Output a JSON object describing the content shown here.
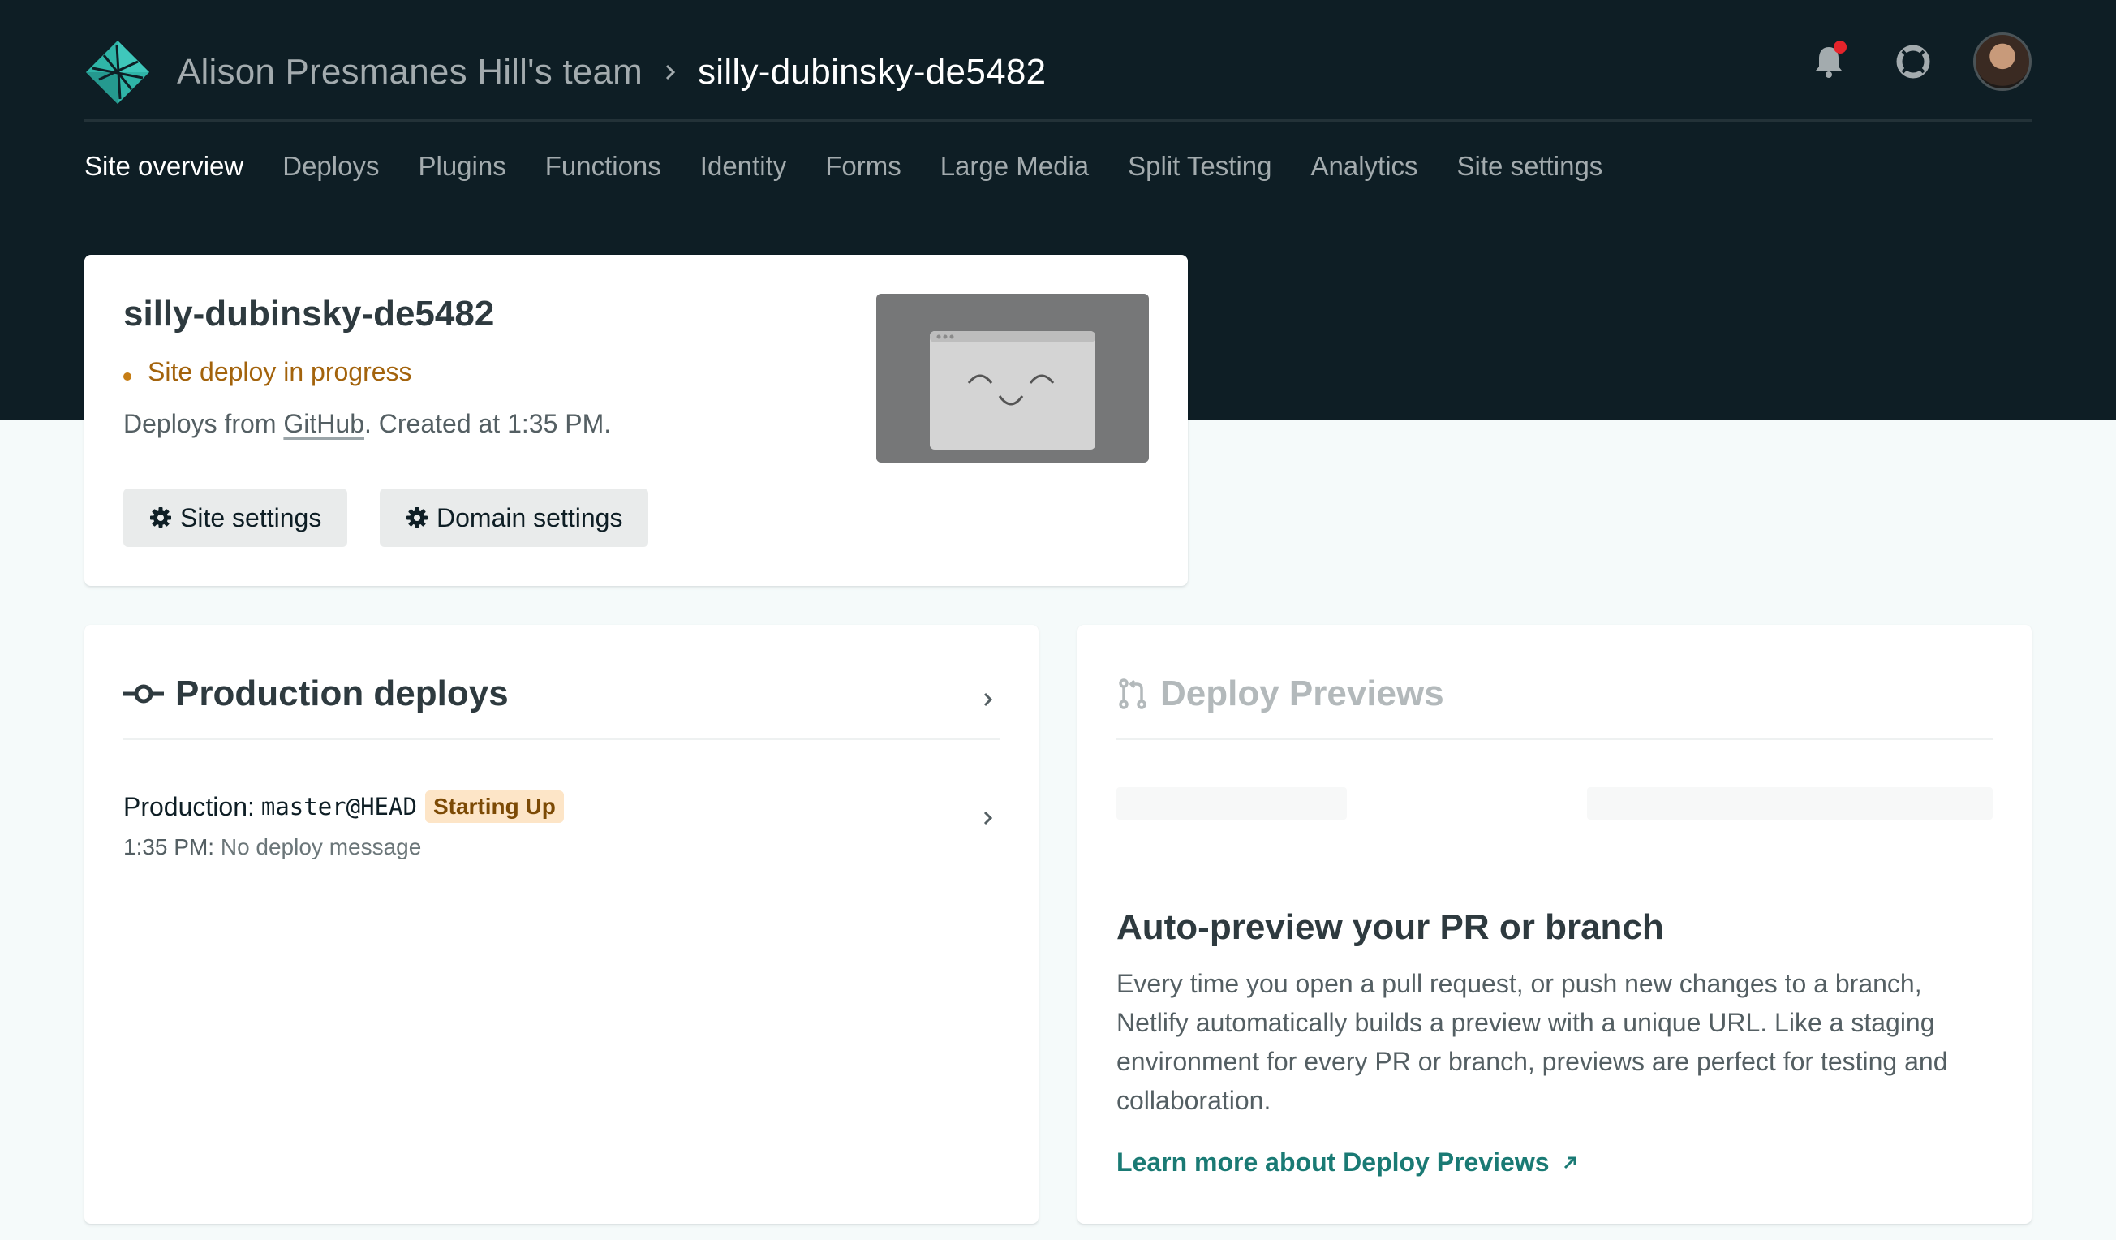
{
  "header": {
    "team_name": "Alison Presmanes Hill's team",
    "site_name": "silly-dubinsky-de5482"
  },
  "nav": {
    "items": [
      {
        "label": "Site overview",
        "active": true
      },
      {
        "label": "Deploys"
      },
      {
        "label": "Plugins"
      },
      {
        "label": "Functions"
      },
      {
        "label": "Identity"
      },
      {
        "label": "Forms"
      },
      {
        "label": "Large Media"
      },
      {
        "label": "Split Testing"
      },
      {
        "label": "Analytics"
      },
      {
        "label": "Site settings"
      }
    ]
  },
  "overview": {
    "title": "silly-dubinsky-de5482",
    "status": "Site deploy in progress",
    "meta_prefix": "Deploys from ",
    "meta_link": "GitHub",
    "meta_suffix": ". Created at 1:35 PM.",
    "site_settings_label": "Site settings",
    "domain_settings_label": "Domain settings"
  },
  "production": {
    "title": "Production deploys",
    "deploy": {
      "context": "Production:",
      "ref": "master@HEAD",
      "badge": "Starting Up",
      "time": "1:35 PM:",
      "message": "No deploy message"
    }
  },
  "previews": {
    "title": "Deploy Previews",
    "heading": "Auto-preview your PR or branch",
    "body": "Every time you open a pull request, or push new changes to a branch, Netlify automatically builds a preview with a unique URL. Like a staging environment for every PR or branch, previews are perfect for testing and collaboration.",
    "link": "Learn more about Deploy Previews"
  },
  "colors": {
    "hero_bg": "#0e1e25",
    "page_bg": "#f5fafa",
    "status_warning": "#a3630c",
    "link_teal": "#1a7a74",
    "notification_dot": "#e5242b"
  },
  "icons": [
    "netlify-logo-icon",
    "chevron-right-icon",
    "bell-icon",
    "help-lifebuoy-icon",
    "gear-icon",
    "commit-icon",
    "pull-request-icon",
    "external-arrow-icon"
  ]
}
